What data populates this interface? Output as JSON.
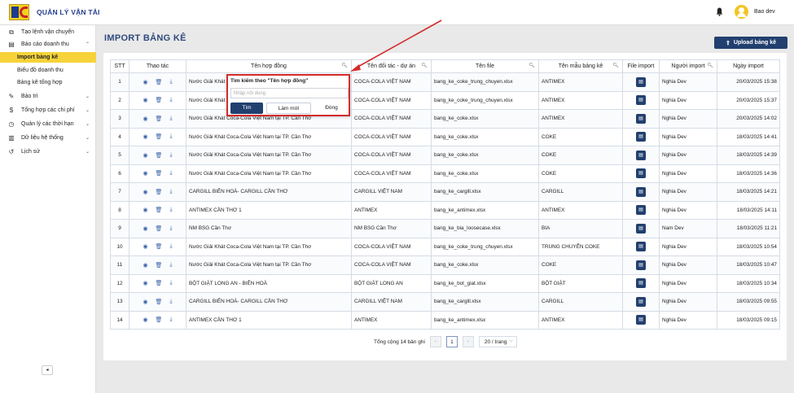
{
  "header": {
    "brand": "QUẢN LÝ VẬN TẢI",
    "username": "Bao dev",
    "icons": [
      "logo",
      "bell-icon",
      "avatar"
    ]
  },
  "sidebar": {
    "items": [
      {
        "label": "Tạo lệnh vận chuyển",
        "icon": "truck-icon",
        "chevron": ""
      },
      {
        "label": "Báo cáo doanh thu",
        "icon": "report-icon",
        "chevron": "⌃"
      },
      {
        "label": "Bảo trì",
        "icon": "wrench-icon",
        "chevron": "⌄"
      },
      {
        "label": "Tổng hợp các chi phí",
        "icon": "dollar-icon",
        "chevron": "⌄"
      },
      {
        "label": "Quản lý các thời hạn",
        "icon": "clock-icon",
        "chevron": "⌄"
      },
      {
        "label": "Dữ liệu hệ thống",
        "icon": "database-icon",
        "chevron": "⌄"
      },
      {
        "label": "Lịch sử",
        "icon": "history-icon",
        "chevron": "⌄"
      }
    ],
    "sub_items": [
      {
        "label": "Import bảng kê",
        "active": true
      },
      {
        "label": "Biểu đồ doanh thu",
        "active": false
      },
      {
        "label": "Bảng kê tổng hợp",
        "active": false
      }
    ],
    "collapse": "◂"
  },
  "page": {
    "title": "IMPORT BẢNG KÊ",
    "upload_label": "Upload bảng kê"
  },
  "table": {
    "columns": [
      "STT",
      "Thao tác",
      "Tên hợp đồng",
      "Tên đối tác - dự án",
      "Tên file",
      "Tên mẫu bảng kê",
      "File import",
      "Người import",
      "Ngày import"
    ],
    "rows": [
      {
        "stt": "1",
        "contract": "Nước Giải Khát C",
        "partner": "COCA-COLA VIỆT NAM",
        "file": "bang_ke_coke_trung_chuyen.xlsx",
        "template": "ANTIMEX",
        "user": "Nghia Dev",
        "date": "20/03/2025 15:38"
      },
      {
        "stt": "2",
        "contract": "Nước Giải Khát C",
        "partner": "COCA-COLA VIỆT NAM",
        "file": "bang_ke_coke_trung_chuyen.xlsx",
        "template": "ANTIMEX",
        "user": "Nghia Dev",
        "date": "20/03/2025 15:37"
      },
      {
        "stt": "3",
        "contract": "Nước Giải Khát Coca-Cola Việt Nam tại TP. Cần Thơ",
        "partner": "COCA-COLA VIỆT NAM",
        "file": "bang_ke_coke.xlsx",
        "template": "ANTIMEX",
        "user": "Nghia Dev",
        "date": "20/03/2025 14:02"
      },
      {
        "stt": "4",
        "contract": "Nước Giải Khát Coca-Cola Việt Nam tại TP. Cần Thơ",
        "partner": "COCA-COLA VIỆT NAM",
        "file": "bang_ke_coke.xlsx",
        "template": "COKE",
        "user": "Nghia Dev",
        "date": "18/03/2025 14:41"
      },
      {
        "stt": "5",
        "contract": "Nước Giải Khát Coca-Cola Việt Nam tại TP. Cần Thơ",
        "partner": "COCA-COLA VIỆT NAM",
        "file": "bang_ke_coke.xlsx",
        "template": "COKE",
        "user": "Nghia Dev",
        "date": "18/03/2025 14:39"
      },
      {
        "stt": "6",
        "contract": "Nước Giải Khát Coca-Cola Việt Nam tại TP. Cần Thơ",
        "partner": "COCA-COLA VIỆT NAM",
        "file": "bang_ke_coke.xlsx",
        "template": "COKE",
        "user": "Nghia Dev",
        "date": "18/03/2025 14:36"
      },
      {
        "stt": "7",
        "contract": "CARGILL BIÊN HOÀ- CARGILL CẦN THƠ",
        "partner": "CARGILL VIỆT NAM",
        "file": "bang_ke_cargill.xlsx",
        "template": "CARGILL",
        "user": "Nghia Dev",
        "date": "18/03/2025 14:21"
      },
      {
        "stt": "8",
        "contract": "ANTIMEX CẦN THƠ 1",
        "partner": "ANTIMEX",
        "file": "bang_ke_antimex.xlsx",
        "template": "ANTIMEX",
        "user": "Nghia Dev",
        "date": "18/03/2025 14:11"
      },
      {
        "stt": "9",
        "contract": "NM BSG Cần Thơ",
        "partner": "NM BSG Cần Thơ",
        "file": "bang_ke_bia_loosecase.xlsx",
        "template": "BIA",
        "user": "Nam Dev",
        "date": "18/03/2025 11:21"
      },
      {
        "stt": "10",
        "contract": "Nước Giải Khát Coca-Cola Việt Nam tại TP. Cần Thơ",
        "partner": "COCA-COLA VIỆT NAM",
        "file": "bang_ke_coke_trung_chuyen.xlsx",
        "template": "TRUNG CHUYỂN COKE",
        "user": "Nghia Dev",
        "date": "18/03/2025 10:54"
      },
      {
        "stt": "11",
        "contract": "Nước Giải Khát Coca-Cola Việt Nam tại TP. Cần Thơ",
        "partner": "COCA-COLA VIỆT NAM",
        "file": "bang_ke_coke.xlsx",
        "template": "COKE",
        "user": "Nghia Dev",
        "date": "18/03/2025 10:47"
      },
      {
        "stt": "12",
        "contract": "BỘT GIẶT LONG AN - BIÊN HOÀ",
        "partner": "BỘT GIẶT LONG AN",
        "file": "bang_ke_bot_giat.xlsx",
        "template": "BỘT GIẶT",
        "user": "Nghia Dev",
        "date": "18/03/2025 10:34"
      },
      {
        "stt": "13",
        "contract": "CARGILL BIÊN HOÀ- CARGILL CẦN THƠ",
        "partner": "CARGILL VIỆT NAM",
        "file": "bang_ke_cargill.xlsx",
        "template": "CARGILL",
        "user": "Nghia Dev",
        "date": "18/03/2025 09:55"
      },
      {
        "stt": "14",
        "contract": "ANTIMEX CẦN THƠ 1",
        "partner": "ANTIMEX",
        "file": "bang_ke_antimex.xlsx",
        "template": "ANTIMEX",
        "user": "Nghia Dev",
        "date": "18/03/2025 09:15"
      }
    ]
  },
  "pagination": {
    "total_label": "Tổng cộng 14 bản ghi",
    "prev": "‹",
    "current": "1",
    "next": "›",
    "page_size": "20 / trang"
  },
  "search_popup": {
    "title": "Tìm kiếm theo \"Tên hợp đồng\"",
    "placeholder": "Nhập nội dung",
    "find_label": "Tìm",
    "reset_label": "Làm mới",
    "close_label": "Đóng"
  },
  "colors": {
    "primary": "#22406f",
    "accent": "#f6d33a",
    "highlight": "#d42b2b"
  }
}
